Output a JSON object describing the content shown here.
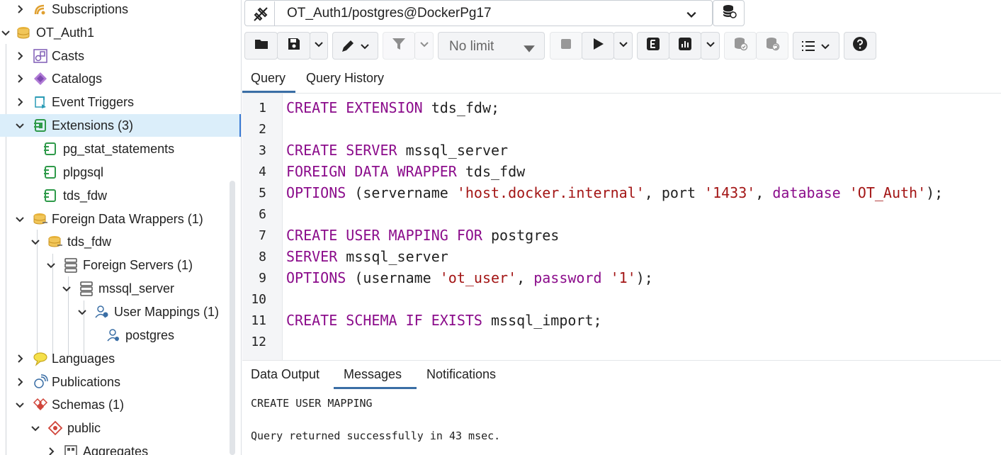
{
  "tree": {
    "items": [
      {
        "label": "Subscriptions",
        "icon": "subscriptions-icon"
      },
      {
        "label": "OT_Auth1",
        "icon": "database-icon"
      },
      {
        "label": "Casts",
        "icon": "casts-icon"
      },
      {
        "label": "Catalogs",
        "icon": "catalogs-icon"
      },
      {
        "label": "Event Triggers",
        "icon": "event-triggers-icon"
      },
      {
        "label": "Extensions (3)",
        "icon": "extensions-icon"
      },
      {
        "label": "pg_stat_statements",
        "icon": "extension-icon"
      },
      {
        "label": "plpgsql",
        "icon": "extension-icon"
      },
      {
        "label": "tds_fdw",
        "icon": "extension-icon"
      },
      {
        "label": "Foreign Data Wrappers (1)",
        "icon": "fdw-icon"
      },
      {
        "label": "tds_fdw",
        "icon": "fdw-icon"
      },
      {
        "label": "Foreign Servers (1)",
        "icon": "foreign-servers-icon"
      },
      {
        "label": "mssql_server",
        "icon": "foreign-server-icon"
      },
      {
        "label": "User Mappings (1)",
        "icon": "user-mappings-icon"
      },
      {
        "label": "postgres",
        "icon": "user-mapping-icon"
      },
      {
        "label": "Languages",
        "icon": "languages-icon"
      },
      {
        "label": "Publications",
        "icon": "publications-icon"
      },
      {
        "label": "Schemas (1)",
        "icon": "schemas-icon"
      },
      {
        "label": "public",
        "icon": "schema-icon"
      },
      {
        "label": "Aggregates",
        "icon": "aggregates-icon"
      }
    ]
  },
  "toolbar": {
    "connection": "OT_Auth1/postgres@DockerPg17",
    "limit": "No limit"
  },
  "query_tabs": [
    "Query",
    "Query History"
  ],
  "editor": {
    "line_numbers": [
      "1",
      "2",
      "3",
      "4",
      "5",
      "6",
      "7",
      "8",
      "9",
      "10",
      "11",
      "12"
    ],
    "lines": [
      [
        {
          "t": "kw",
          "v": "CREATE EXTENSION"
        },
        {
          "t": "pl",
          "v": " tds_fdw;"
        }
      ],
      [],
      [
        {
          "t": "kw",
          "v": "CREATE SERVER"
        },
        {
          "t": "pl",
          "v": " mssql_server"
        }
      ],
      [
        {
          "t": "kw",
          "v": "FOREIGN DATA WRAPPER"
        },
        {
          "t": "pl",
          "v": " tds_fdw"
        }
      ],
      [
        {
          "t": "kw",
          "v": "OPTIONS"
        },
        {
          "t": "pl",
          "v": " (servername "
        },
        {
          "t": "str",
          "v": "'host.docker.internal'"
        },
        {
          "t": "pl",
          "v": ", port "
        },
        {
          "t": "str",
          "v": "'1433'"
        },
        {
          "t": "pl",
          "v": ", "
        },
        {
          "t": "kw",
          "v": "database"
        },
        {
          "t": "pl",
          "v": " "
        },
        {
          "t": "str",
          "v": "'OT_Auth'"
        },
        {
          "t": "pl",
          "v": ");"
        }
      ],
      [],
      [
        {
          "t": "kw",
          "v": "CREATE USER MAPPING FOR"
        },
        {
          "t": "pl",
          "v": " postgres"
        }
      ],
      [
        {
          "t": "kw",
          "v": "SERVER"
        },
        {
          "t": "pl",
          "v": " mssql_server"
        }
      ],
      [
        {
          "t": "kw",
          "v": "OPTIONS"
        },
        {
          "t": "pl",
          "v": " (username "
        },
        {
          "t": "str",
          "v": "'ot_user'"
        },
        {
          "t": "pl",
          "v": ", "
        },
        {
          "t": "kw",
          "v": "password"
        },
        {
          "t": "pl",
          "v": " "
        },
        {
          "t": "str",
          "v": "'1'"
        },
        {
          "t": "pl",
          "v": ");"
        }
      ],
      [],
      [
        {
          "t": "kw",
          "v": "CREATE SCHEMA IF EXISTS"
        },
        {
          "t": "pl",
          "v": " mssql_import;"
        }
      ],
      []
    ]
  },
  "result_tabs": [
    "Data Output",
    "Messages",
    "Notifications"
  ],
  "messages": {
    "line1": "CREATE USER MAPPING",
    "line2": "Query returned successfully in 43 msec."
  },
  "colors": {
    "keyword": "#8b0c8b",
    "string": "#a31515",
    "accent": "#3a6ea5",
    "selected_row": "#dbeefa"
  }
}
